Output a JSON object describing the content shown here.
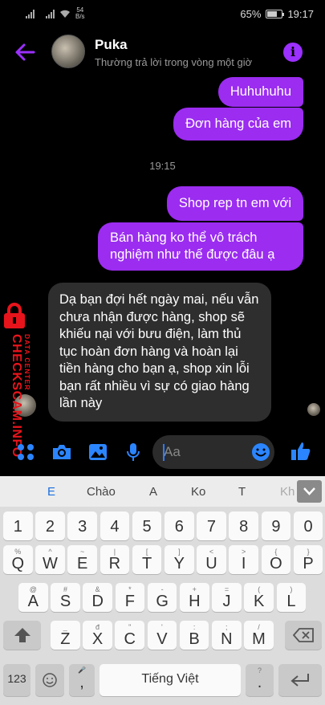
{
  "status_bar": {
    "net_speed_value": "54",
    "net_speed_unit": "B/s",
    "battery": "65%",
    "time": "19:17"
  },
  "header": {
    "name": "Puka",
    "status": "Thường trả lời trong vòng một giờ"
  },
  "messages": {
    "out1": "Huhuhuhu",
    "out2": "Đơn hàng của em",
    "timestamp": "19:15",
    "out3": "Shop rep tn em với",
    "out4_line1": "Bán hàng ko thể vô trách",
    "out4_line2": "nghiệm như thế được đâu ạ",
    "in1": "Dạ bạn đợi hết ngày mai, nếu vẫn chưa nhận được hàng, shop sẽ khiếu nại với bưu điện, làm thủ tục hoàn đơn hàng và hoàn lại tiền hàng cho bạn ạ, shop xin lỗi bạn rất nhiều vì sự có giao hàng lần này"
  },
  "watermark": {
    "main": "CHECKSCAM.INFO",
    "sub": "DATA CENTER"
  },
  "composer": {
    "placeholder": "Aa"
  },
  "keyboard": {
    "suggestions": [
      "E",
      "Chào",
      "A",
      "Ko",
      "T",
      "Kh"
    ],
    "row_numbers": [
      "1",
      "2",
      "3",
      "4",
      "5",
      "6",
      "7",
      "8",
      "9",
      "0"
    ],
    "row1": [
      {
        "m": "Q",
        "h": "%"
      },
      {
        "m": "W",
        "h": "^"
      },
      {
        "m": "E",
        "h": "~"
      },
      {
        "m": "R",
        "h": "|"
      },
      {
        "m": "T",
        "h": "["
      },
      {
        "m": "Y",
        "h": "]"
      },
      {
        "m": "U",
        "h": "<"
      },
      {
        "m": "I",
        "h": ">"
      },
      {
        "m": "O",
        "h": "{"
      },
      {
        "m": "P",
        "h": "}"
      }
    ],
    "row2": [
      {
        "m": "A",
        "h": "@"
      },
      {
        "m": "S",
        "h": "#"
      },
      {
        "m": "D",
        "h": "&"
      },
      {
        "m": "F",
        "h": "*"
      },
      {
        "m": "G",
        "h": "-"
      },
      {
        "m": "H",
        "h": "+"
      },
      {
        "m": "J",
        "h": "="
      },
      {
        "m": "K",
        "h": "("
      },
      {
        "m": "L",
        "h": ")"
      }
    ],
    "row3": [
      {
        "m": "Z",
        "h": "_"
      },
      {
        "m": "X",
        "h": "đ"
      },
      {
        "m": "C",
        "h": "\""
      },
      {
        "m": "V",
        "h": "'"
      },
      {
        "m": "B",
        "h": ":"
      },
      {
        "m": "N",
        "h": ";"
      },
      {
        "m": "M",
        "h": "/"
      }
    ],
    "key_123": "123",
    "key_comma": ",",
    "key_period": ".",
    "key_comma_hint": "🎤",
    "key_period_hint": "?",
    "space_label": "Tiếng Việt"
  },
  "colors": {
    "outgoing_bubble": "#9b2cf0",
    "incoming_bubble": "#2e2e2e",
    "accent_blue": "#2b85ff",
    "watermark_red": "#e8141b"
  }
}
